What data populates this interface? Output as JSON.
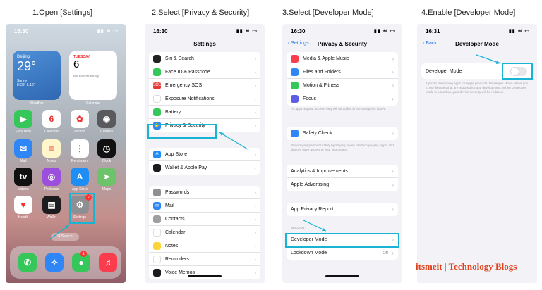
{
  "steps": [
    "1.Open [Settings]",
    "2.Select [Privacy & Security]",
    "3.Select [Developer Mode]",
    "4.Enable [Developer Mode]"
  ],
  "colors": {
    "highlight": "#19b3d4",
    "link": "#1a73e8",
    "watermark": "#e0401c"
  },
  "phone1": {
    "time": "16:30",
    "weather": {
      "city": "Beijing",
      "temp": "29°",
      "cond": "Sunny",
      "range": "H:33° L:18°",
      "label": "Weather"
    },
    "calendar": {
      "dow": "TUESDAY",
      "day": "6",
      "events": "No events today",
      "label": "Calendar"
    },
    "apps": [
      {
        "label": "FaceTime",
        "icon": "facetime-icon",
        "color": "#35c759",
        "glyph": "▶"
      },
      {
        "label": "Calendar",
        "icon": "calendar-icon",
        "color": "#ffffff",
        "glyph": "6"
      },
      {
        "label": "Photos",
        "icon": "photos-icon",
        "color": "#ffffff",
        "glyph": "✿"
      },
      {
        "label": "Camera",
        "icon": "camera-icon",
        "color": "#5a5a5e",
        "glyph": "◉"
      },
      {
        "label": "Mail",
        "icon": "mail-icon",
        "color": "#2f86f6",
        "glyph": "✉"
      },
      {
        "label": "Notes",
        "icon": "notes-icon",
        "color": "#fff6c9",
        "glyph": "≡"
      },
      {
        "label": "Reminders",
        "icon": "reminders-icon",
        "color": "#ffffff",
        "glyph": "⋮"
      },
      {
        "label": "Clock",
        "icon": "clock-icon",
        "color": "#111111",
        "glyph": "◷"
      },
      {
        "label": "Videos",
        "icon": "tv-icon",
        "color": "#111111",
        "glyph": "tv"
      },
      {
        "label": "Podcasts",
        "icon": "podcasts-icon",
        "color": "#9b4fdc",
        "glyph": "◎"
      },
      {
        "label": "App Store",
        "icon": "app-store-icon",
        "color": "#1e8ef6",
        "glyph": "A"
      },
      {
        "label": "Maps",
        "icon": "maps-icon",
        "color": "#6cc36a",
        "glyph": "➤"
      },
      {
        "label": "Health",
        "icon": "health-icon",
        "color": "#ffffff",
        "glyph": "♥"
      },
      {
        "label": "Wallet",
        "icon": "wallet-icon",
        "color": "#1c1c1e",
        "glyph": "▤"
      },
      {
        "label": "Settings",
        "icon": "settings-gear-icon",
        "color": "#8e8e93",
        "glyph": "⚙"
      }
    ],
    "settings_badge": "2",
    "search": "Q Search",
    "dock": [
      {
        "icon": "phone-icon",
        "color": "#35c759",
        "glyph": "✆"
      },
      {
        "icon": "safari-icon",
        "color": "#2f86f6",
        "glyph": "✧"
      },
      {
        "icon": "messages-icon",
        "color": "#35c759",
        "glyph": "●"
      },
      {
        "icon": "music-icon",
        "color": "#fa3c4c",
        "glyph": "♫"
      }
    ],
    "messages_badge": "1"
  },
  "phone2": {
    "time": "16:30",
    "title": "Settings",
    "groups": [
      [
        {
          "label": "Siri & Search",
          "icon": "siri-icon",
          "color": "#222"
        },
        {
          "label": "Face ID & Passcode",
          "icon": "faceid-icon",
          "color": "#35c759"
        },
        {
          "label": "Emergency SOS",
          "icon": "sos-icon",
          "color": "#e53935",
          "glyph": "SOS"
        },
        {
          "label": "Exposure Notifications",
          "icon": "exposure-icon",
          "color": "#ffffff"
        },
        {
          "label": "Battery",
          "icon": "battery-icon",
          "color": "#35c759"
        },
        {
          "label": "Privacy & Security",
          "icon": "privacy-hand-icon",
          "color": "#2f86f6",
          "glyph": "✋"
        }
      ],
      [
        {
          "label": "App Store",
          "icon": "app-store-icon",
          "color": "#1e8ef6",
          "glyph": "A"
        },
        {
          "label": "Wallet & Apple Pay",
          "icon": "wallet-icon",
          "color": "#1c1c1e"
        }
      ],
      [
        {
          "label": "Passwords",
          "icon": "key-icon",
          "color": "#8e8e93"
        },
        {
          "label": "Mail",
          "icon": "mail-icon",
          "color": "#2f86f6",
          "glyph": "✉"
        },
        {
          "label": "Contacts",
          "icon": "contacts-icon",
          "color": "#9e9ea3"
        },
        {
          "label": "Calendar",
          "icon": "calendar-icon",
          "color": "#ffffff"
        },
        {
          "label": "Notes",
          "icon": "notes-icon",
          "color": "#ffd43b"
        },
        {
          "label": "Reminders",
          "icon": "reminders-icon",
          "color": "#ffffff"
        },
        {
          "label": "Voice Memos",
          "icon": "voice-memos-icon",
          "color": "#1c1c1e"
        }
      ]
    ]
  },
  "phone3": {
    "time": "16:30",
    "back": "Settings",
    "title": "Privacy & Security",
    "group1": [
      {
        "label": "Media & Apple Music",
        "icon": "music-icon",
        "color": "#fa3c4c"
      },
      {
        "label": "Files and Folders",
        "icon": "folder-icon",
        "color": "#2f86f6"
      },
      {
        "label": "Motion & Fitness",
        "icon": "fitness-icon",
        "color": "#35c759"
      },
      {
        "label": "Focus",
        "icon": "moon-icon",
        "color": "#5e5ce6"
      }
    ],
    "note1": "As apps request access, they will be added in the categories above.",
    "group2": [
      {
        "label": "Safety Check",
        "icon": "safety-check-icon",
        "color": "#2f86f6"
      }
    ],
    "note2": "Protect your personal safety by staying aware of which people, apps, and devices have access to your information.",
    "group3": [
      "Analytics & Improvements",
      "Apple Advertising"
    ],
    "group4": [
      "App Privacy Report"
    ],
    "section": "SECURITY",
    "group5": [
      {
        "label": "Developer Mode",
        "value": ""
      },
      {
        "label": "Lockdown Mode",
        "value": "Off"
      }
    ]
  },
  "phone4": {
    "time": "16:31",
    "back": "Back",
    "title": "Developer Mode",
    "toggle_label": "Developer Mode",
    "toggle_on": false,
    "footer": "If you're developing apps for Apple products, Developer Mode allows you to use features that are required for app development. When Developer Mode is turned on, your device security will be reduced."
  },
  "watermark": "itsmeit | Technology Blogs"
}
